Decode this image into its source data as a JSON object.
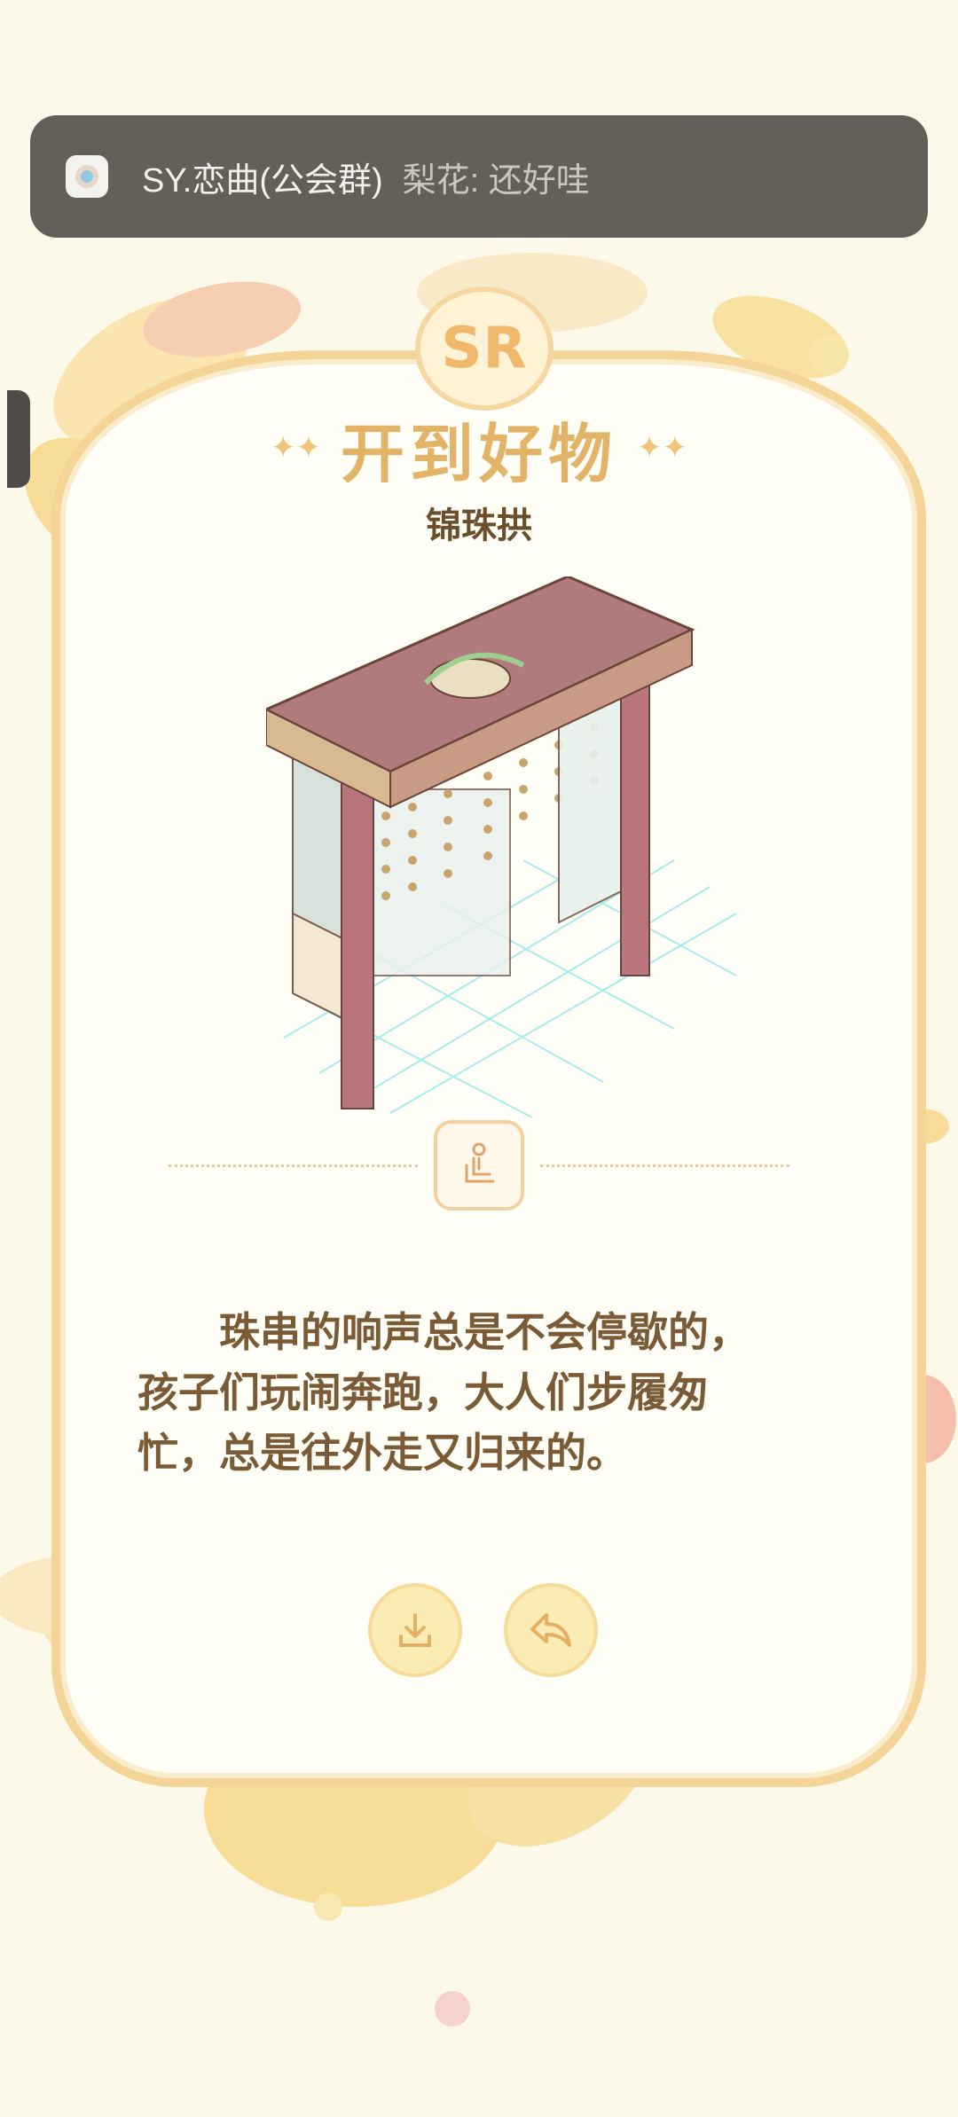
{
  "notification": {
    "group_name": "SY.恋曲(公会群)",
    "message": "梨花: 还好哇",
    "app_icon": "chat-app-icon"
  },
  "card": {
    "rarity": "SR",
    "title": "开到好物",
    "item_name": "锦珠拱",
    "category_icon": "sit-icon",
    "description": "珠串的响声总是不会停歇的，\n孩子们玩闹奔跑，大人们步履匆\n忙，总是往外走又归来的。"
  },
  "actions": {
    "download_icon": "download-icon",
    "share_icon": "share-icon"
  },
  "colors": {
    "background": "#fdf9ea",
    "card_border": "#f4d597",
    "title": "#e3b468",
    "text": "#7b5a36",
    "notification_bg": "#5e5a52"
  }
}
